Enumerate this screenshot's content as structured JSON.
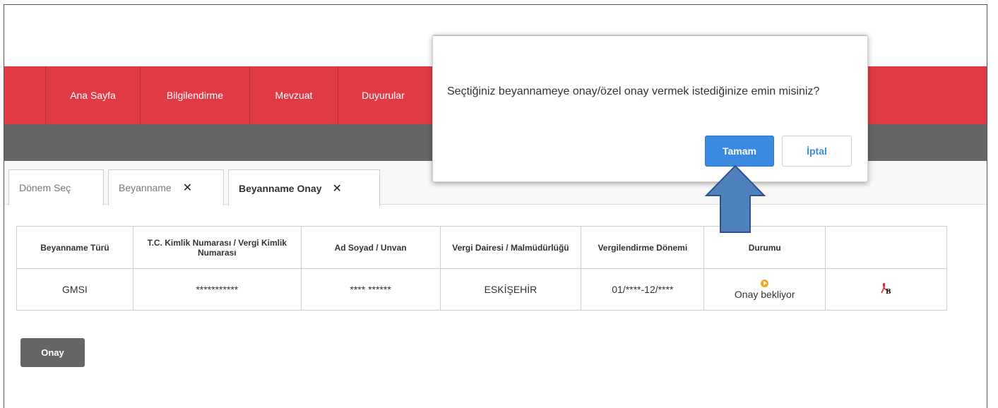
{
  "nav": {
    "items": [
      {
        "label": "Ana Sayfa"
      },
      {
        "label": "Bilgilendirme"
      },
      {
        "label": "Mevzuat"
      },
      {
        "label": "Duyurular"
      }
    ]
  },
  "tabs": [
    {
      "label": "Dönem Seç",
      "closable": false
    },
    {
      "label": "Beyanname",
      "closable": true
    },
    {
      "label": "Beyanname Onay",
      "closable": true
    }
  ],
  "tab_close_glyph": "✕",
  "table": {
    "headers": [
      "Beyanname Türü",
      "T.C. Kimlik Numarası / Vergi Kimlik Numarası",
      "Ad Soyad / Unvan",
      "Vergi Dairesi / Malmüdürlüğü",
      "Vergilendirme Dönemi",
      "Durumu",
      ""
    ],
    "rows": [
      {
        "type": "GMSI",
        "id": "***********",
        "name": "**** ******",
        "office": "ESKİŞEHİR",
        "period": "01/****-12/****",
        "status": "Onay bekliyor",
        "status_icon": "pending-play-icon",
        "action_icon": "pdf-icon"
      }
    ]
  },
  "onay_button": "Onay",
  "dialog": {
    "message": "Seçtiğiniz beyannameye onay/özel onay vermek istediğinize emin misiniz?",
    "ok_label": "Tamam",
    "cancel_label": "İptal"
  },
  "colors": {
    "nav_red": "#e03a45",
    "grey_bar": "#666666",
    "ok_blue": "#3a8ae0",
    "arrow_blue": "#4f81bd",
    "status_orange": "#f5a623"
  }
}
